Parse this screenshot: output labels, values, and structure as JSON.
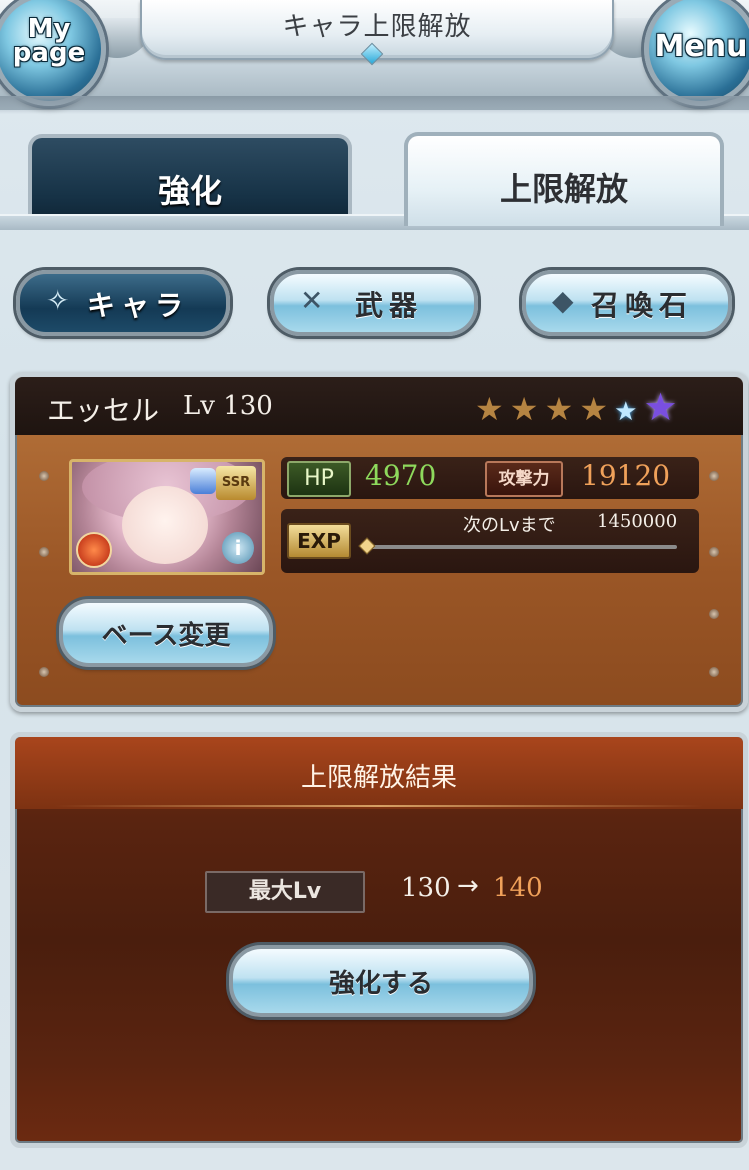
{
  "header": {
    "title": "キャラ上限解放",
    "mypage_label": "My\npage",
    "menu_label": "Menu"
  },
  "tabs": [
    {
      "label": "強化",
      "active": false
    },
    {
      "label": "上限解放",
      "active": true
    }
  ],
  "categories": [
    {
      "label": "キャラ",
      "icon": "character-icon",
      "selected": true
    },
    {
      "label": "武器",
      "icon": "weapon-icon",
      "selected": false
    },
    {
      "label": "召喚石",
      "icon": "summon-icon",
      "selected": false
    }
  ],
  "character": {
    "name": "エッセル",
    "level": "Lv 130",
    "stars": {
      "bronze": 4,
      "blue": 1,
      "purple": 1
    },
    "rarity": "SSR",
    "hp_label": "HP",
    "hp_value": "4970",
    "atk_label": "攻撃力",
    "atk_value": "19120",
    "exp_label": "EXP",
    "next_lv_label": "次のLvまで",
    "next_lv_value": "1450000",
    "exp_progress": 0.0,
    "base_change_label": "ベース変更"
  },
  "result": {
    "title": "上限解放結果",
    "max_lv_label": "最大Lv",
    "lv_from": "130",
    "arrow": "→",
    "lv_to": "140",
    "enhance_label": "強化する"
  },
  "colors": {
    "hp_value": "#8ed95c",
    "atk_value": "#f0a15a",
    "lv_to": "#f0a15a",
    "panel_brown": "#9a5626",
    "result_brown": "#4a1e0d"
  }
}
